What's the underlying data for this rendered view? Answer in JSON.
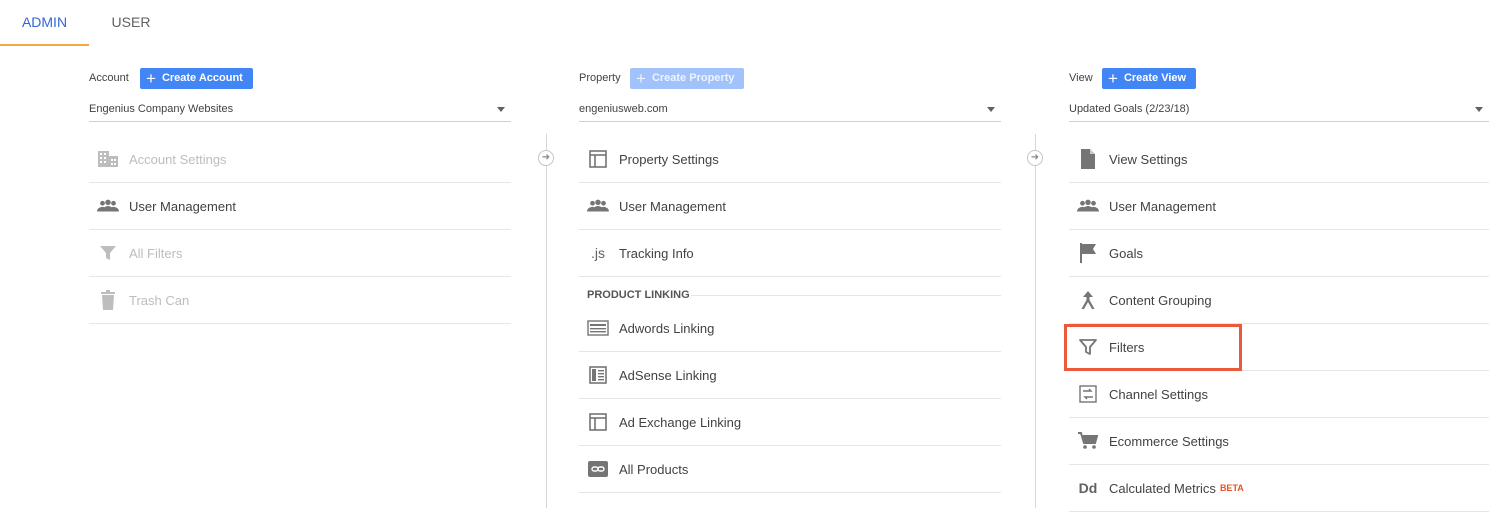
{
  "tabs": [
    {
      "label": "ADMIN",
      "active": true
    },
    {
      "label": "USER",
      "active": false
    }
  ],
  "columns": {
    "account": {
      "label": "Account",
      "create_label": "Create Account",
      "selected": "Engenius Company Websites",
      "items": [
        {
          "label": "Account Settings",
          "icon": "building-icon",
          "disabled": true
        },
        {
          "label": "User Management",
          "icon": "people-icon",
          "disabled": false
        },
        {
          "label": "All Filters",
          "icon": "filter-icon",
          "disabled": true
        },
        {
          "label": "Trash Can",
          "icon": "trash-icon",
          "disabled": true
        }
      ]
    },
    "property": {
      "label": "Property",
      "create_label": "Create Property",
      "selected": "engeniusweb.com",
      "items": [
        {
          "label": "Property Settings",
          "icon": "window-icon"
        },
        {
          "label": "User Management",
          "icon": "people-icon"
        },
        {
          "label": "Tracking Info",
          "icon": "js-icon"
        }
      ],
      "section_label": "PRODUCT LINKING",
      "linking_items": [
        {
          "label": "Adwords Linking",
          "icon": "adwords-icon"
        },
        {
          "label": "AdSense Linking",
          "icon": "adsense-icon"
        },
        {
          "label": "Ad Exchange Linking",
          "icon": "adexchange-icon"
        },
        {
          "label": "All Products",
          "icon": "link-icon"
        }
      ]
    },
    "view": {
      "label": "View",
      "create_label": "Create View",
      "selected": "Updated Goals (2/23/18)",
      "items": [
        {
          "label": "View Settings",
          "icon": "document-icon"
        },
        {
          "label": "User Management",
          "icon": "people-icon"
        },
        {
          "label": "Goals",
          "icon": "flag-icon"
        },
        {
          "label": "Content Grouping",
          "icon": "grouping-icon"
        },
        {
          "label": "Filters",
          "icon": "filter-icon"
        },
        {
          "label": "Channel Settings",
          "icon": "channel-icon"
        },
        {
          "label": "Ecommerce Settings",
          "icon": "cart-icon"
        },
        {
          "label": "Calculated Metrics",
          "icon": "dd-icon",
          "badge": "BETA"
        }
      ]
    }
  },
  "colors": {
    "accent": "#4285f4",
    "tab_active": "#3367d6",
    "tab_underline": "#f4a742",
    "highlight": "#ea5a3a",
    "beta": "#e8541e"
  }
}
